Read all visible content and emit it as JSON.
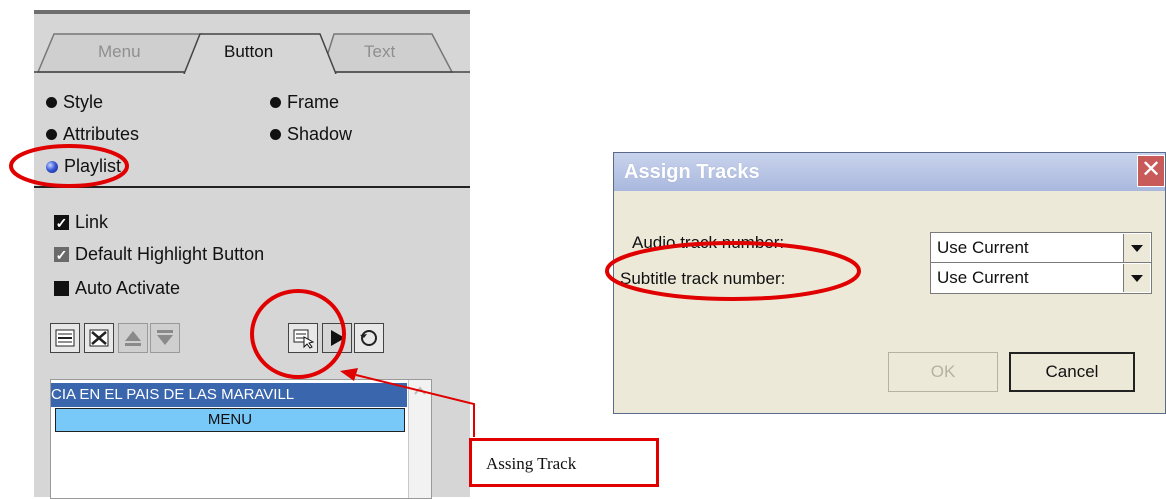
{
  "left_panel": {
    "tabs": [
      {
        "label": "Menu",
        "active": false
      },
      {
        "label": "Button",
        "active": true
      },
      {
        "label": "Text",
        "active": false
      }
    ],
    "radios": [
      {
        "label": "Style",
        "selected": false
      },
      {
        "label": "Frame",
        "selected": false
      },
      {
        "label": "Attributes",
        "selected": false
      },
      {
        "label": "Shadow",
        "selected": false
      },
      {
        "label": "Playlist",
        "selected": true
      }
    ],
    "checkboxes": [
      {
        "label": "Link",
        "checked": true
      },
      {
        "label": "Default Highlight Button",
        "checked": true,
        "disabled": true
      },
      {
        "label": "Auto Activate",
        "checked": false
      }
    ],
    "toolbar_icons": [
      "add-item-icon",
      "remove-item-icon",
      "move-up-icon",
      "move-down-icon",
      "assign-track-icon",
      "play-icon",
      "loop-icon"
    ],
    "playlist": {
      "title": "CIA EN EL PAIS DE LAS MARAVILL",
      "rows": [
        "MENU"
      ]
    }
  },
  "dialog": {
    "title": "Assign Tracks",
    "close_label": "✕",
    "audio_label": "Audio track number:",
    "audio_value": "Use Current",
    "subtitle_label": "Subtitle track number:",
    "subtitle_value": "Use Current",
    "ok_label": "OK",
    "cancel_label": "Cancel"
  },
  "annotations": {
    "callout_text": "Assing Track",
    "color": "#e00000"
  }
}
